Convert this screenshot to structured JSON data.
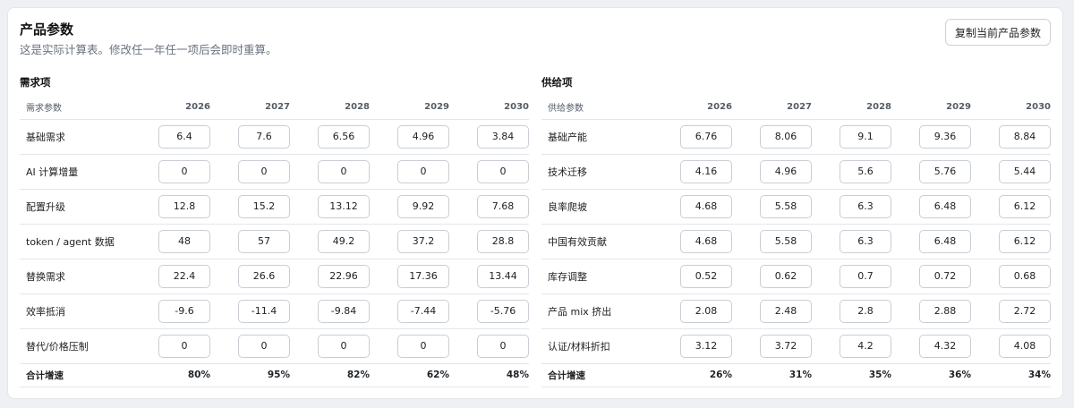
{
  "header": {
    "title": "产品参数",
    "subtitle": "这是实际计算表。修改任一年任一项后会即时重算。",
    "copy_button": "复制当前产品参数"
  },
  "demand": {
    "title": "需求项",
    "label_header": "需求参数",
    "years": [
      "2026",
      "2027",
      "2028",
      "2029",
      "2030"
    ],
    "rows": [
      {
        "label": "基础需求",
        "values": [
          "6.4",
          "7.6",
          "6.56",
          "4.96",
          "3.84"
        ]
      },
      {
        "label": "AI 计算增量",
        "values": [
          "0",
          "0",
          "0",
          "0",
          "0"
        ]
      },
      {
        "label": "配置升级",
        "values": [
          "12.8",
          "15.2",
          "13.12",
          "9.92",
          "7.68"
        ]
      },
      {
        "label": "token / agent 数据",
        "values": [
          "48",
          "57",
          "49.2",
          "37.2",
          "28.8"
        ]
      },
      {
        "label": "替换需求",
        "values": [
          "22.4",
          "26.6",
          "22.96",
          "17.36",
          "13.44"
        ]
      },
      {
        "label": "效率抵消",
        "values": [
          "-9.6",
          "-11.4",
          "-9.84",
          "-7.44",
          "-5.76"
        ]
      },
      {
        "label": "替代/价格压制",
        "values": [
          "0",
          "0",
          "0",
          "0",
          "0"
        ]
      }
    ],
    "total": {
      "label": "合计增速",
      "values": [
        "80%",
        "95%",
        "82%",
        "62%",
        "48%"
      ]
    }
  },
  "supply": {
    "title": "供给项",
    "label_header": "供给参数",
    "years": [
      "2026",
      "2027",
      "2028",
      "2029",
      "2030"
    ],
    "rows": [
      {
        "label": "基础产能",
        "values": [
          "6.76",
          "8.06",
          "9.1",
          "9.36",
          "8.84"
        ]
      },
      {
        "label": "技术迁移",
        "values": [
          "4.16",
          "4.96",
          "5.6",
          "5.76",
          "5.44"
        ]
      },
      {
        "label": "良率爬坡",
        "values": [
          "4.68",
          "5.58",
          "6.3",
          "6.48",
          "6.12"
        ]
      },
      {
        "label": "中国有效贡献",
        "values": [
          "4.68",
          "5.58",
          "6.3",
          "6.48",
          "6.12"
        ]
      },
      {
        "label": "库存调整",
        "values": [
          "0.52",
          "0.62",
          "0.7",
          "0.72",
          "0.68"
        ]
      },
      {
        "label": "产品 mix 挤出",
        "values": [
          "2.08",
          "2.48",
          "2.8",
          "2.88",
          "2.72"
        ]
      },
      {
        "label": "认证/材料折扣",
        "values": [
          "3.12",
          "3.72",
          "4.2",
          "4.32",
          "4.08"
        ]
      }
    ],
    "total": {
      "label": "合计增速",
      "values": [
        "26%",
        "31%",
        "35%",
        "36%",
        "34%"
      ]
    }
  }
}
